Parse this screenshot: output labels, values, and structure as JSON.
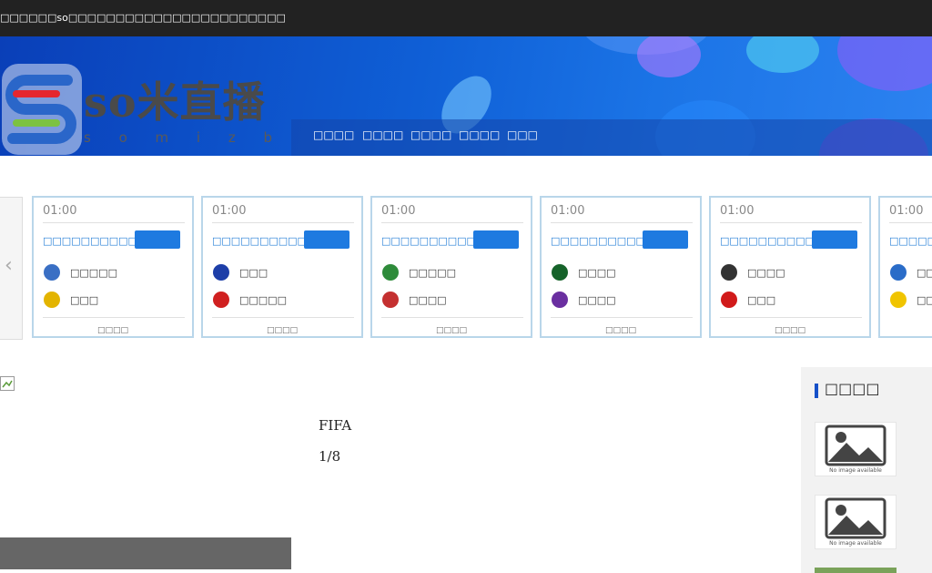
{
  "topbar": {
    "text": "□□□□□□so□□□□□□□□□□□□□□□□□□□□□□□"
  },
  "logo": {
    "main": "so米直播",
    "sub": "s o m i z b"
  },
  "nav": {
    "items": [
      "□□□□",
      "□□□□",
      "□□□□",
      "□□□□",
      "□□□"
    ]
  },
  "carousel": {
    "cards": [
      {
        "time": "01:00",
        "title": "□□□□□□□□□□□□",
        "home": "□□□□□",
        "away": "□□□",
        "footer": "□□□□",
        "home_color": "#3a6fc4",
        "away_color": "#e3b400"
      },
      {
        "time": "01:00",
        "title": "□□□□□□□□□□□□□□",
        "home": "□□□",
        "away": "□□□□□",
        "footer": "□□□□",
        "home_color": "#1d3ea8",
        "away_color": "#d02020"
      },
      {
        "time": "01:00",
        "title": "□□□□□□□□□□□□□□",
        "home": "□□□□□",
        "away": "□□□□",
        "footer": "□□□□",
        "home_color": "#2e8b3a",
        "away_color": "#c43030"
      },
      {
        "time": "01:00",
        "title": "□□□□□□□□□□□□□□",
        "home": "□□□□",
        "away": "□□□□",
        "footer": "□□□□",
        "home_color": "#16632a",
        "away_color": "#6a2fa0"
      },
      {
        "time": "01:00",
        "title": "□□□□□□□□□□□□□",
        "home": "□□□□",
        "away": "□□□",
        "footer": "□□□□",
        "home_color": "#333333",
        "away_color": "#d11a1a"
      },
      {
        "time": "01:00",
        "title": "□□□□□□□□□□□□□",
        "home": "□□□□",
        "away": "□□□□",
        "footer": "□□□□",
        "home_color": "#2a6cc8",
        "away_color": "#f0c400"
      }
    ]
  },
  "main": {
    "title": "FIFA",
    "pager": "1/8"
  },
  "sidebar": {
    "title": "□□□□",
    "thumb_caption": "No image available"
  }
}
